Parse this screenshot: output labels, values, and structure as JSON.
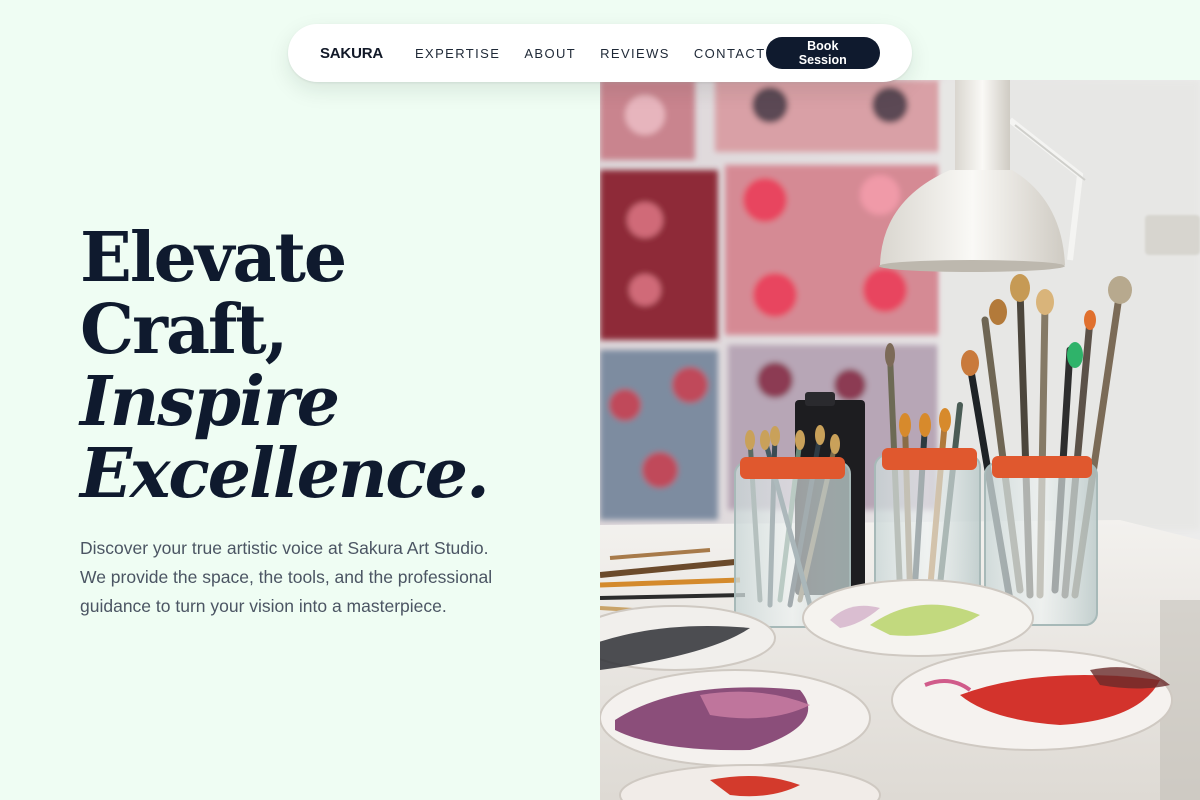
{
  "nav": {
    "brand": "SAKURA",
    "links": [
      "EXPERTISE",
      "ABOUT",
      "REVIEWS",
      "CONTACT"
    ],
    "cta": "Book Session"
  },
  "hero": {
    "title_lines": [
      "Elevate",
      "Craft,",
      "Inspire",
      "Excellence."
    ],
    "description": "Discover your true artistic voice at Sakura Art Studio. We provide the space, the tools, and the professional guidance to turn your vision into a masterpiece."
  },
  "image": {
    "subject": "art-studio-brushes-and-palettes"
  },
  "colors": {
    "background": "#effdf3",
    "ink": "#0f1a2e",
    "body_text": "#4b5563",
    "cta_bg": "#0f1a2e",
    "cta_text": "#ffffff"
  }
}
